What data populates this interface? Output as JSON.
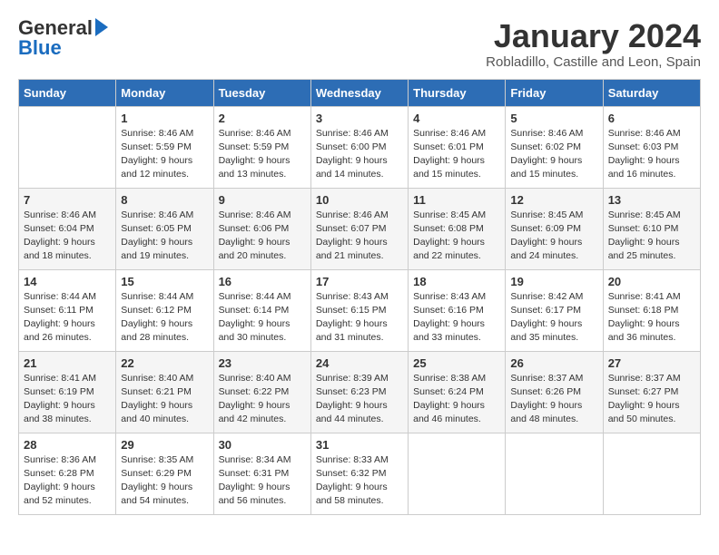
{
  "header": {
    "logo_general": "General",
    "logo_blue": "Blue",
    "month_title": "January 2024",
    "location": "Robladillo, Castille and Leon, Spain"
  },
  "weekdays": [
    "Sunday",
    "Monday",
    "Tuesday",
    "Wednesday",
    "Thursday",
    "Friday",
    "Saturday"
  ],
  "weeks": [
    [
      {
        "day": "",
        "info": ""
      },
      {
        "day": "1",
        "info": "Sunrise: 8:46 AM\nSunset: 5:59 PM\nDaylight: 9 hours\nand 12 minutes."
      },
      {
        "day": "2",
        "info": "Sunrise: 8:46 AM\nSunset: 5:59 PM\nDaylight: 9 hours\nand 13 minutes."
      },
      {
        "day": "3",
        "info": "Sunrise: 8:46 AM\nSunset: 6:00 PM\nDaylight: 9 hours\nand 14 minutes."
      },
      {
        "day": "4",
        "info": "Sunrise: 8:46 AM\nSunset: 6:01 PM\nDaylight: 9 hours\nand 15 minutes."
      },
      {
        "day": "5",
        "info": "Sunrise: 8:46 AM\nSunset: 6:02 PM\nDaylight: 9 hours\nand 15 minutes."
      },
      {
        "day": "6",
        "info": "Sunrise: 8:46 AM\nSunset: 6:03 PM\nDaylight: 9 hours\nand 16 minutes."
      }
    ],
    [
      {
        "day": "7",
        "info": "Sunrise: 8:46 AM\nSunset: 6:04 PM\nDaylight: 9 hours\nand 18 minutes."
      },
      {
        "day": "8",
        "info": "Sunrise: 8:46 AM\nSunset: 6:05 PM\nDaylight: 9 hours\nand 19 minutes."
      },
      {
        "day": "9",
        "info": "Sunrise: 8:46 AM\nSunset: 6:06 PM\nDaylight: 9 hours\nand 20 minutes."
      },
      {
        "day": "10",
        "info": "Sunrise: 8:46 AM\nSunset: 6:07 PM\nDaylight: 9 hours\nand 21 minutes."
      },
      {
        "day": "11",
        "info": "Sunrise: 8:45 AM\nSunset: 6:08 PM\nDaylight: 9 hours\nand 22 minutes."
      },
      {
        "day": "12",
        "info": "Sunrise: 8:45 AM\nSunset: 6:09 PM\nDaylight: 9 hours\nand 24 minutes."
      },
      {
        "day": "13",
        "info": "Sunrise: 8:45 AM\nSunset: 6:10 PM\nDaylight: 9 hours\nand 25 minutes."
      }
    ],
    [
      {
        "day": "14",
        "info": "Sunrise: 8:44 AM\nSunset: 6:11 PM\nDaylight: 9 hours\nand 26 minutes."
      },
      {
        "day": "15",
        "info": "Sunrise: 8:44 AM\nSunset: 6:12 PM\nDaylight: 9 hours\nand 28 minutes."
      },
      {
        "day": "16",
        "info": "Sunrise: 8:44 AM\nSunset: 6:14 PM\nDaylight: 9 hours\nand 30 minutes."
      },
      {
        "day": "17",
        "info": "Sunrise: 8:43 AM\nSunset: 6:15 PM\nDaylight: 9 hours\nand 31 minutes."
      },
      {
        "day": "18",
        "info": "Sunrise: 8:43 AM\nSunset: 6:16 PM\nDaylight: 9 hours\nand 33 minutes."
      },
      {
        "day": "19",
        "info": "Sunrise: 8:42 AM\nSunset: 6:17 PM\nDaylight: 9 hours\nand 35 minutes."
      },
      {
        "day": "20",
        "info": "Sunrise: 8:41 AM\nSunset: 6:18 PM\nDaylight: 9 hours\nand 36 minutes."
      }
    ],
    [
      {
        "day": "21",
        "info": "Sunrise: 8:41 AM\nSunset: 6:19 PM\nDaylight: 9 hours\nand 38 minutes."
      },
      {
        "day": "22",
        "info": "Sunrise: 8:40 AM\nSunset: 6:21 PM\nDaylight: 9 hours\nand 40 minutes."
      },
      {
        "day": "23",
        "info": "Sunrise: 8:40 AM\nSunset: 6:22 PM\nDaylight: 9 hours\nand 42 minutes."
      },
      {
        "day": "24",
        "info": "Sunrise: 8:39 AM\nSunset: 6:23 PM\nDaylight: 9 hours\nand 44 minutes."
      },
      {
        "day": "25",
        "info": "Sunrise: 8:38 AM\nSunset: 6:24 PM\nDaylight: 9 hours\nand 46 minutes."
      },
      {
        "day": "26",
        "info": "Sunrise: 8:37 AM\nSunset: 6:26 PM\nDaylight: 9 hours\nand 48 minutes."
      },
      {
        "day": "27",
        "info": "Sunrise: 8:37 AM\nSunset: 6:27 PM\nDaylight: 9 hours\nand 50 minutes."
      }
    ],
    [
      {
        "day": "28",
        "info": "Sunrise: 8:36 AM\nSunset: 6:28 PM\nDaylight: 9 hours\nand 52 minutes."
      },
      {
        "day": "29",
        "info": "Sunrise: 8:35 AM\nSunset: 6:29 PM\nDaylight: 9 hours\nand 54 minutes."
      },
      {
        "day": "30",
        "info": "Sunrise: 8:34 AM\nSunset: 6:31 PM\nDaylight: 9 hours\nand 56 minutes."
      },
      {
        "day": "31",
        "info": "Sunrise: 8:33 AM\nSunset: 6:32 PM\nDaylight: 9 hours\nand 58 minutes."
      },
      {
        "day": "",
        "info": ""
      },
      {
        "day": "",
        "info": ""
      },
      {
        "day": "",
        "info": ""
      }
    ]
  ]
}
